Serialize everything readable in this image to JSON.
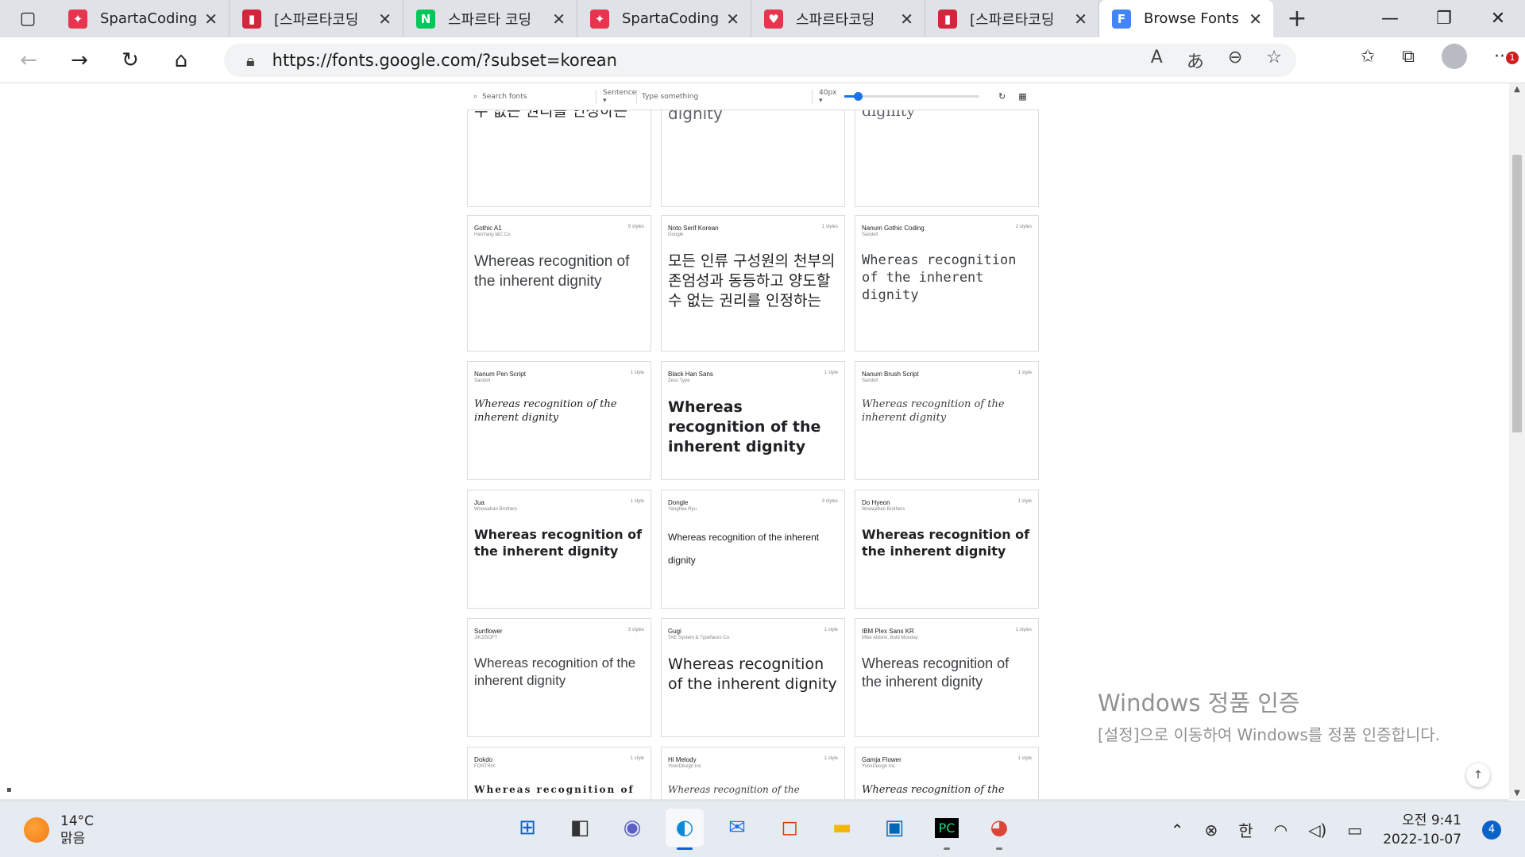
{
  "tabs": [
    {
      "title": "SpartaCodingC",
      "favicon_color": "#e8344e",
      "favicon_glyph": "✦"
    },
    {
      "title": "[스파르타코딩",
      "favicon_color": "#d5253d",
      "favicon_glyph": "▮"
    },
    {
      "title": "스파르타 코딩",
      "favicon_color": "#03c75a",
      "favicon_glyph": "N"
    },
    {
      "title": "SpartaCodingC",
      "favicon_color": "#e8344e",
      "favicon_glyph": "✦"
    },
    {
      "title": "스파르타코딩",
      "favicon_color": "#e8344e",
      "favicon_glyph": "♥"
    },
    {
      "title": "[스파르타코딩",
      "favicon_color": "#d5253d",
      "favicon_glyph": "▮"
    },
    {
      "title": "Browse Fonts -",
      "favicon_color": "#4285f4",
      "favicon_glyph": "F",
      "active": true
    }
  ],
  "address": {
    "url": "https://fonts.google.com/?subset=korean"
  },
  "more_badge": "1",
  "fontbar": {
    "search_placeholder": "Search fonts",
    "mode": "Sentence ▾",
    "type_placeholder": "Type something",
    "size": "40px ▾",
    "slider_value": 0.1
  },
  "cards": [
    {
      "name": "",
      "designer": "",
      "styles": "",
      "sample": "모든 인류 구성원의 천부의 존엄성과 동등하고 양도할 수 없는 권리를 인정하는",
      "font": "DejaVu Sans",
      "color": "#202124"
    },
    {
      "name": "",
      "designer": "",
      "styles": "",
      "sample": "Whereas recognition of the inherent dignity",
      "font": "DejaVu Sans",
      "color": "#5f6368"
    },
    {
      "name": "",
      "designer": "",
      "styles": "",
      "sample": "Whereas recognition of the inherent dignity",
      "font": "DejaVu Serif",
      "color": "#5f6368"
    },
    {
      "name": "Gothic A1",
      "designer": "HanYang I&C Co",
      "styles": "9 styles",
      "sample": "Whereas recognition of the inherent dignity",
      "font": "Liberation Sans",
      "color": "#3c4043"
    },
    {
      "name": "Noto Serif Korean",
      "designer": "Google",
      "styles": "1 styles",
      "sample": "모든 인류 구성원의 천부의 존엄성과 동등하고 양도할 수 없는 권리를 인정하는",
      "font": "DejaVu Serif",
      "color": "#202124"
    },
    {
      "name": "Nanum Gothic Coding",
      "designer": "Sandoll",
      "styles": "2 styles",
      "sample": "Whereas recognition of the inherent dignity",
      "font": "DejaVu Sans Mono",
      "color": "#3c4043"
    },
    {
      "name": "Nanum Pen Script",
      "designer": "Sandoll",
      "styles": "1 style",
      "sample": "Whereas recognition of the inherent dignity",
      "font": "DejaVu Serif",
      "color": "#202124"
    },
    {
      "name": "Black Han Sans",
      "designer": "Zess Type",
      "styles": "1 style",
      "sample": "Whereas recognition of the inherent dignity",
      "font": "DejaVu Sans",
      "color": "#202124"
    },
    {
      "name": "Nanum Brush Script",
      "designer": "Sandoll",
      "styles": "1 style",
      "sample": "Whereas recognition of the inherent dignity",
      "font": "DejaVu Serif",
      "color": "#3c4043"
    },
    {
      "name": "Jua",
      "designer": "Woowahan Brothers",
      "styles": "1 style",
      "sample": "Whereas recognition of the inherent dignity",
      "font": "DejaVu Sans",
      "color": "#202124"
    },
    {
      "name": "Dongle",
      "designer": "Yanghee Ryu",
      "styles": "3 styles",
      "sample": "Whereas recognition of the inherent dignity",
      "font": "Liberation Sans",
      "color": "#202124"
    },
    {
      "name": "Do Hyeon",
      "designer": "Woowahan Brothers",
      "styles": "1 style",
      "sample": "Whereas recognition of the inherent dignity",
      "font": "DejaVu Sans",
      "color": "#202124"
    },
    {
      "name": "Sunflower",
      "designer": "JIKJISOFT",
      "styles": "3 styles",
      "sample": "Whereas recognition of the inherent dignity",
      "font": "Liberation Sans",
      "color": "#3c4043"
    },
    {
      "name": "Gugi",
      "designer": "TAE System & Typefaces Co.",
      "styles": "1 style",
      "sample": "Whereas recognition of the inherent dignity",
      "font": "DejaVu Sans",
      "color": "#202124"
    },
    {
      "name": "IBM Plex Sans KR",
      "designer": "Mike Abbink, Bold Monday",
      "styles": "1 styles",
      "sample": "Whereas recognition of the inherent dignity",
      "font": "Liberation Sans",
      "color": "#3c4043"
    },
    {
      "name": "Dokdo",
      "designer": "FONTRIX",
      "styles": "1 style",
      "sample": "Whereas recognition of",
      "font": "DejaVu Serif",
      "color": "#202124"
    },
    {
      "name": "Hi Melody",
      "designer": "YoonDesign Inc",
      "styles": "1 style",
      "sample": "Whereas recognition of the",
      "font": "DejaVu Serif",
      "color": "#3c4043"
    },
    {
      "name": "Gamja Flower",
      "designer": "YoonDesign Inc",
      "styles": "1 style",
      "sample": "Whereas recognition of the",
      "font": "DejaVu Serif",
      "color": "#202124"
    }
  ],
  "activation": {
    "title": "Windows 정품 인증",
    "message": "[설정]으로 이동하여 Windows를 정품 인증합니다."
  },
  "taskbar": {
    "temperature": "14°C",
    "condition": "맑음",
    "ime": "한",
    "time": "오전 9:41",
    "date": "2022-10-07",
    "notifications": "4"
  }
}
